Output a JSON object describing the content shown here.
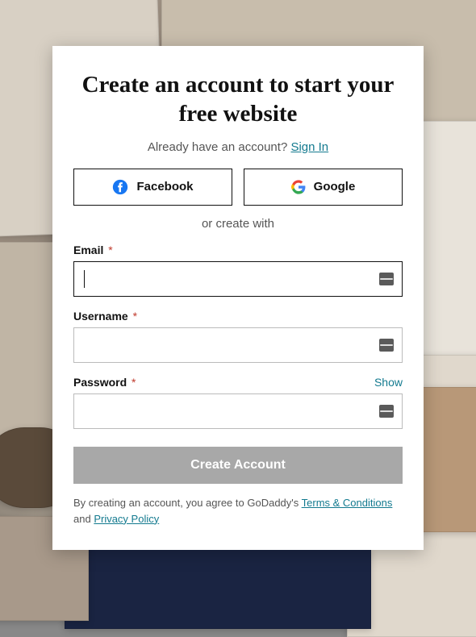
{
  "title": "Create an account to start your free website",
  "haveAccount": {
    "text": "Already have an account? ",
    "linkText": "Sign In"
  },
  "social": {
    "facebook": "Facebook",
    "google": "Google"
  },
  "orCreateWith": "or create with",
  "fields": {
    "email": {
      "label": "Email",
      "value": ""
    },
    "username": {
      "label": "Username",
      "value": ""
    },
    "password": {
      "label": "Password",
      "value": "",
      "showLabel": "Show"
    }
  },
  "requiredMark": "*",
  "submit": "Create Account",
  "disclaimer": {
    "prefix": "By creating an account, you agree to GoDaddy's ",
    "termsLabel": "Terms & Conditions",
    "middle": " and ",
    "privacyLabel": "Privacy Policy"
  }
}
